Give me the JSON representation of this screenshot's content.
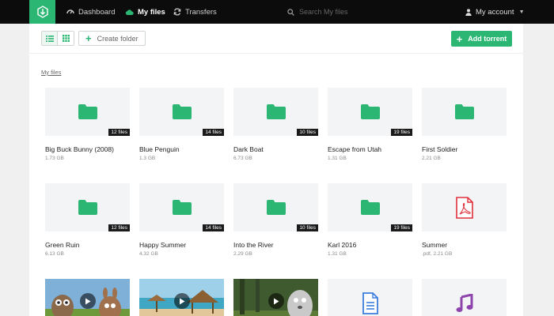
{
  "nav": {
    "items": [
      {
        "label": "Dashboard",
        "icon": "speedometer-icon"
      },
      {
        "label": "My files",
        "icon": "cloud-icon"
      },
      {
        "label": "Transfers",
        "icon": "refresh-icon"
      }
    ],
    "search_placeholder": "Search My files",
    "account_label": "My account"
  },
  "toolbar": {
    "create_folder_label": "Create folder",
    "add_torrent_label": "Add torrent"
  },
  "breadcrumb": "My files",
  "files": [
    {
      "name": "Big Buck Bunny (2008)",
      "size": "1.73 GB",
      "badge": "12 files",
      "type": "folder"
    },
    {
      "name": "Blue Penguin",
      "size": "1.3 GB",
      "badge": "14 files",
      "type": "folder"
    },
    {
      "name": "Dark Boat",
      "size": "6.73 GB",
      "badge": "10 files",
      "type": "folder"
    },
    {
      "name": "Escape from Utah",
      "size": "1.31 GB",
      "badge": "19 files",
      "type": "folder"
    },
    {
      "name": "First Soldier",
      "size": "2.21 GB",
      "badge": "",
      "type": "folder"
    },
    {
      "name": "Green Ruin",
      "size": "6.13 GB",
      "badge": "12 files",
      "type": "folder"
    },
    {
      "name": "Happy Summer",
      "size": "4.32 GB",
      "badge": "14 files",
      "type": "folder"
    },
    {
      "name": "Into the River",
      "size": "2.29 GB",
      "badge": "10 files",
      "type": "folder"
    },
    {
      "name": "Karl 2016",
      "size": "1.31 GB",
      "badge": "19 files",
      "type": "folder"
    },
    {
      "name": "Summer",
      "size": ".pdf, 2.21 GB",
      "badge": "",
      "type": "pdf"
    },
    {
      "name": "",
      "size": "",
      "badge": "",
      "type": "video-bunny"
    },
    {
      "name": "",
      "size": "",
      "badge": "",
      "type": "video-beach"
    },
    {
      "name": "",
      "size": "",
      "badge": "",
      "type": "video-forest"
    },
    {
      "name": "",
      "size": "",
      "badge": "",
      "type": "document"
    },
    {
      "name": "",
      "size": "",
      "badge": "",
      "type": "audio"
    }
  ],
  "colors": {
    "accent": "#2bb673",
    "topbar": "#0c0c0c",
    "pdf": "#e0303b",
    "document": "#3b7ddd",
    "audio": "#8e44ad"
  }
}
